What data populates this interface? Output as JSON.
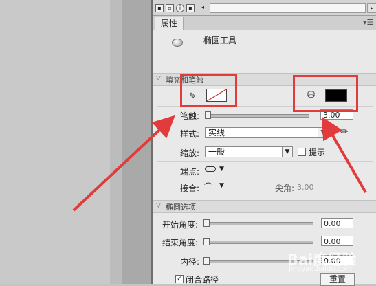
{
  "timeline": {
    "icons": [
      "new-layer-icon",
      "new-folder-icon",
      "motion-guide-icon",
      "delete-icon",
      "scroll-left-icon"
    ]
  },
  "tabs": {
    "properties": "属性"
  },
  "tool": {
    "name": "椭圆工具"
  },
  "fill_stroke": {
    "title": "填充和笔触",
    "stroke_color": "none",
    "fill_color": "#000000",
    "stroke_width_label": "笔触:",
    "stroke_width_value": "3.00",
    "style_label": "样式:",
    "style_value": "实线",
    "scale_label": "缩放:",
    "scale_value": "一般",
    "hint_label": "提示",
    "cap_label": "端点:",
    "join_label": "接合:",
    "miter_label": "尖角:",
    "miter_value": "3.00"
  },
  "oval_options": {
    "title": "椭圆选项",
    "start_angle_label": "开始角度:",
    "start_angle_value": "0.00",
    "end_angle_label": "结束角度:",
    "end_angle_value": "0.00",
    "inner_radius_label": "内径:",
    "inner_radius_value": "0.00",
    "close_path_label": "闭合路径",
    "close_path_checked": true,
    "reset_label": "重置"
  },
  "annotations": {
    "color": "#e23b3b"
  },
  "watermark": {
    "text": "Bai度经验",
    "sub": "jingyan.baidu.com"
  }
}
